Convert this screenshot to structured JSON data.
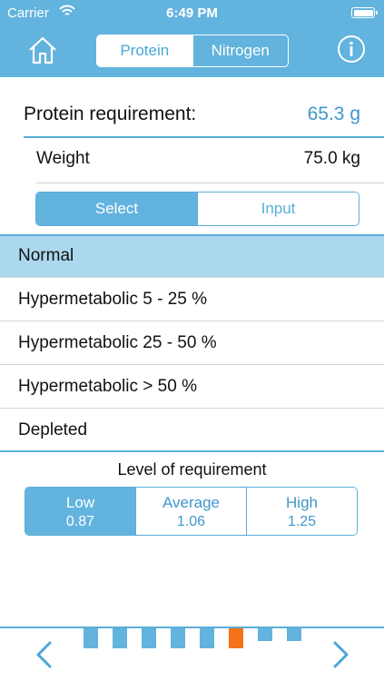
{
  "status_bar": {
    "carrier": "Carrier",
    "time": "6:49 PM"
  },
  "header": {
    "tabs": [
      {
        "label": "Protein",
        "active": true
      },
      {
        "label": "Nitrogen",
        "active": false
      }
    ],
    "home_icon": "home-icon",
    "info_icon": "info-icon"
  },
  "requirement": {
    "label": "Protein requirement:",
    "value": "65.3 g"
  },
  "weight": {
    "label": "Weight",
    "value": "75.0 kg"
  },
  "entry_mode": {
    "options": [
      {
        "label": "Select",
        "active": true
      },
      {
        "label": "Input",
        "active": false
      }
    ]
  },
  "conditions": [
    {
      "label": "Normal",
      "selected": true
    },
    {
      "label": "Hypermetabolic 5 - 25 %",
      "selected": false
    },
    {
      "label": "Hypermetabolic 25 - 50 %",
      "selected": false
    },
    {
      "label": "Hypermetabolic > 50 %",
      "selected": false
    },
    {
      "label": "Depleted",
      "selected": false
    }
  ],
  "level": {
    "title": "Level of requirement",
    "options": [
      {
        "name": "Low",
        "value": "0.87",
        "active": true
      },
      {
        "name": "Average",
        "value": "1.06",
        "active": false
      },
      {
        "name": "High",
        "value": "1.25",
        "active": false
      }
    ]
  },
  "pager": {
    "total": 8,
    "current_index": 5
  },
  "colors": {
    "accent": "#62b3de",
    "accent_dark": "#3f97c9",
    "selected_row": "#acd8ef",
    "current_page": "#f47318"
  },
  "nav": {
    "prev_icon": "chevron-left-icon",
    "next_icon": "chevron-right-icon"
  }
}
